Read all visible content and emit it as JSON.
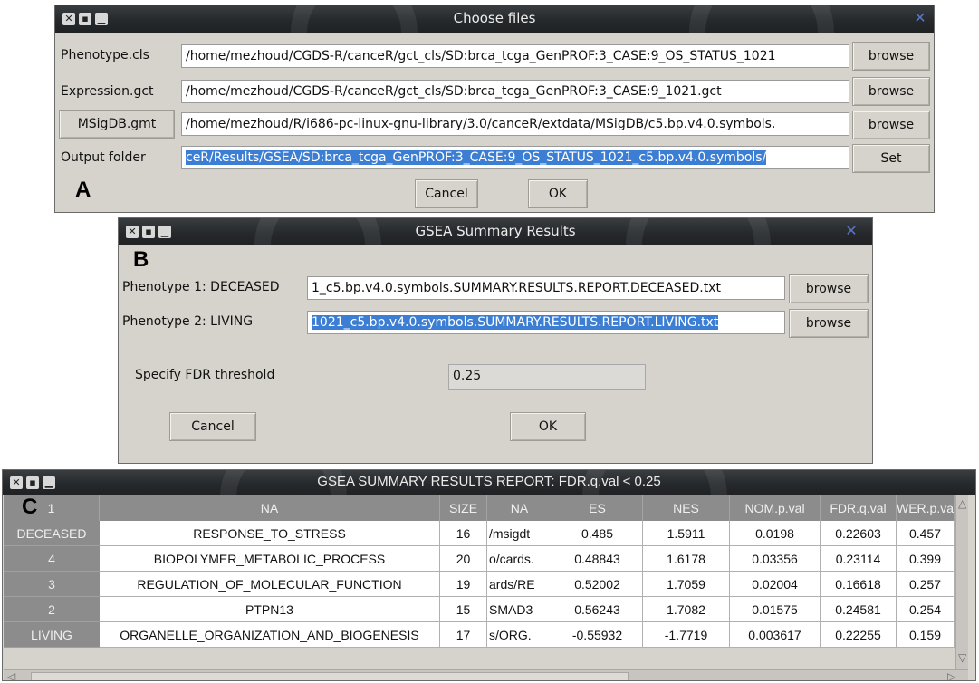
{
  "panel_a": {
    "letter": "A",
    "title": "Choose files",
    "rows": [
      {
        "label": "Phenotype.cls",
        "value": "/home/mezhoud/CGDS-R/canceR/gct_cls/SD:brca_tcga_GenPROF:3_CASE:9_OS_STATUS_1021",
        "button": "browse"
      },
      {
        "label": "Expression.gct",
        "value": "/home/mezhoud/CGDS-R/canceR/gct_cls/SD:brca_tcga_GenPROF:3_CASE:9_1021.gct",
        "button": "browse"
      },
      {
        "label": "MSigDB.gmt",
        "value": "/home/mezhoud/R/i686-pc-linux-gnu-library/3.0/canceR/extdata/MSigDB/c5.bp.v4.0.symbols.",
        "button": "browse"
      },
      {
        "label": "Output folder",
        "value": "ceR/Results/GSEA/SD:brca_tcga_GenPROF:3_CASE:9_OS_STATUS_1021_c5.bp.v4.0.symbols/",
        "button": "Set"
      }
    ],
    "cancel": "Cancel",
    "ok": "OK"
  },
  "panel_b": {
    "letter": "B",
    "title": "GSEA Summary Results",
    "phenotype1_label": "Phenotype 1:  DECEASED",
    "phenotype1_value": "1_c5.bp.v4.0.symbols.SUMMARY.RESULTS.REPORT.DECEASED.txt",
    "phenotype2_label": "Phenotype 2:  LIVING",
    "phenotype2_value": "1021_c5.bp.v4.0.symbols.SUMMARY.RESULTS.REPORT.LIVING.txt",
    "browse": "browse",
    "fdr_label": "Specify FDR threshold",
    "fdr_value": "0.25",
    "cancel": "Cancel",
    "ok": "OK"
  },
  "panel_c": {
    "letter": "C",
    "title": "GSEA SUMMARY RESULTS REPORT: FDR.q.val < 0.25",
    "headers": [
      "1",
      "NA",
      "SIZE",
      "NA",
      "ES",
      "NES",
      "NOM.p.val",
      "FDR.q.val",
      "WER.p.va"
    ],
    "rows": [
      {
        "head": "DECEASED",
        "cells": [
          "RESPONSE_TO_STRESS",
          "16",
          "/msigdt",
          "0.485",
          "1.5911",
          "0.0198",
          "0.22603",
          "0.457"
        ]
      },
      {
        "head": "4",
        "cells": [
          "BIOPOLYMER_METABOLIC_PROCESS",
          "20",
          "o/cards.",
          "0.48843",
          "1.6178",
          "0.03356",
          "0.23114",
          "0.399"
        ]
      },
      {
        "head": "3",
        "cells": [
          "REGULATION_OF_MOLECULAR_FUNCTION",
          "19",
          "ards/RE",
          "0.52002",
          "1.7059",
          "0.02004",
          "0.16618",
          "0.257"
        ]
      },
      {
        "head": "2",
        "cells": [
          "PTPN13",
          "15",
          "SMAD3",
          "0.56243",
          "1.7082",
          "0.01575",
          "0.24581",
          "0.254"
        ]
      },
      {
        "head": "LIVING",
        "cells": [
          "ORGANELLE_ORGANIZATION_AND_BIOGENESIS",
          "17",
          "s/ORG.",
          "-0.55932",
          "-1.7719",
          "0.003617",
          "0.22255",
          "0.159"
        ]
      }
    ]
  },
  "icons": {
    "close": "close-icon",
    "maximize": "maximize-icon",
    "minimize": "minimize-icon",
    "corner": "window-menu-icon"
  },
  "colors": {
    "selection": "#3b7ed3",
    "titlebar": "#26292c",
    "window_bg": "#d6d2cc",
    "header_bg": "#8c8c8c"
  }
}
